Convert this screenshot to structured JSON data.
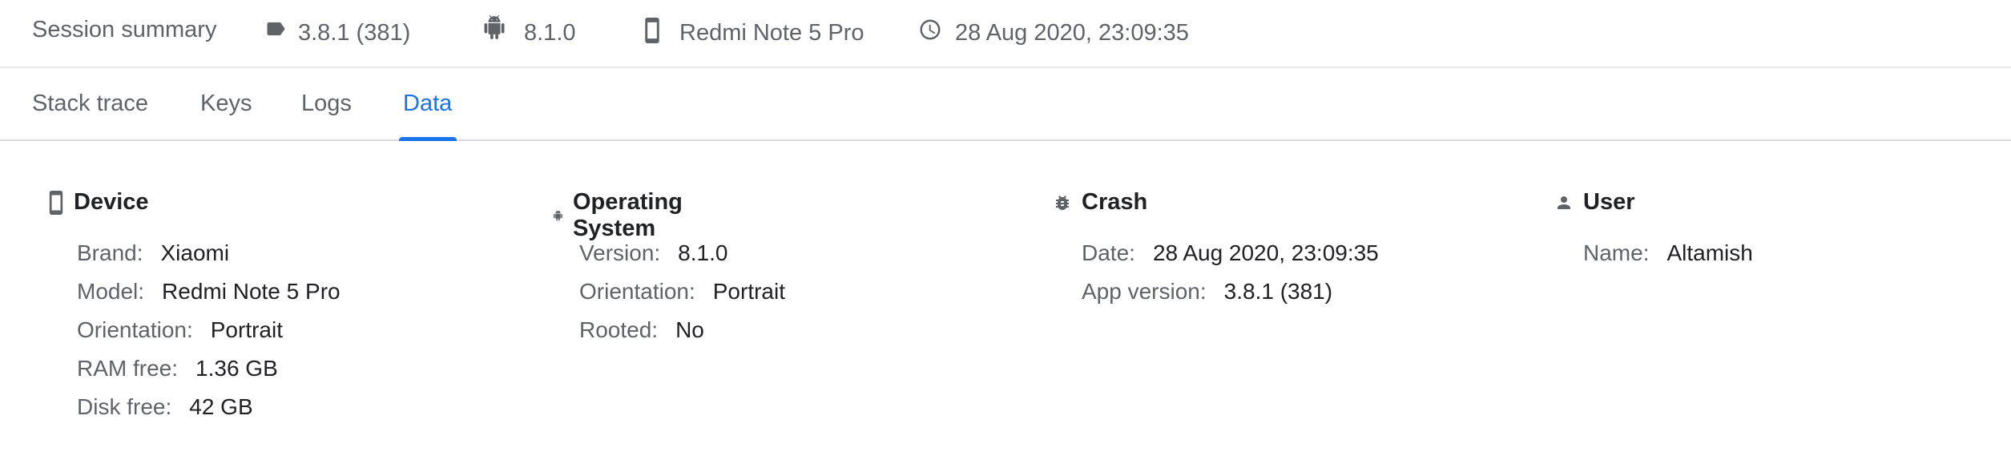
{
  "summary": {
    "title": "Session summary",
    "app_version": "3.8.1 (381)",
    "os_version": "8.1.0",
    "device": "Redmi Note 5 Pro",
    "timestamp": "28 Aug 2020, 23:09:35"
  },
  "tabs": [
    {
      "label": "Stack trace"
    },
    {
      "label": "Keys"
    },
    {
      "label": "Logs"
    },
    {
      "label": "Data",
      "active": true
    }
  ],
  "sections": {
    "device": {
      "title": "Device",
      "rows": [
        {
          "k": "Brand:",
          "v": "Xiaomi"
        },
        {
          "k": "Model:",
          "v": "Redmi Note 5 Pro"
        },
        {
          "k": "Orientation:",
          "v": "Portrait"
        },
        {
          "k": "RAM free:",
          "v": "1.36 GB"
        },
        {
          "k": "Disk free:",
          "v": "42 GB"
        }
      ]
    },
    "os": {
      "title": "Operating System",
      "rows": [
        {
          "k": "Version:",
          "v": "8.1.0"
        },
        {
          "k": "Orientation:",
          "v": "Portrait"
        },
        {
          "k": "Rooted:",
          "v": "No"
        }
      ]
    },
    "crash": {
      "title": "Crash",
      "rows": [
        {
          "k": "Date:",
          "v": "28 Aug 2020, 23:09:35"
        },
        {
          "k": "App version:",
          "v": "3.8.1 (381)"
        }
      ]
    },
    "user": {
      "title": "User",
      "rows": [
        {
          "k": "Name:",
          "v": "Altamish"
        }
      ]
    }
  },
  "colors": {
    "accent": "#1a73e8",
    "muted_text": "#5f6368",
    "primary_text": "#202124"
  }
}
